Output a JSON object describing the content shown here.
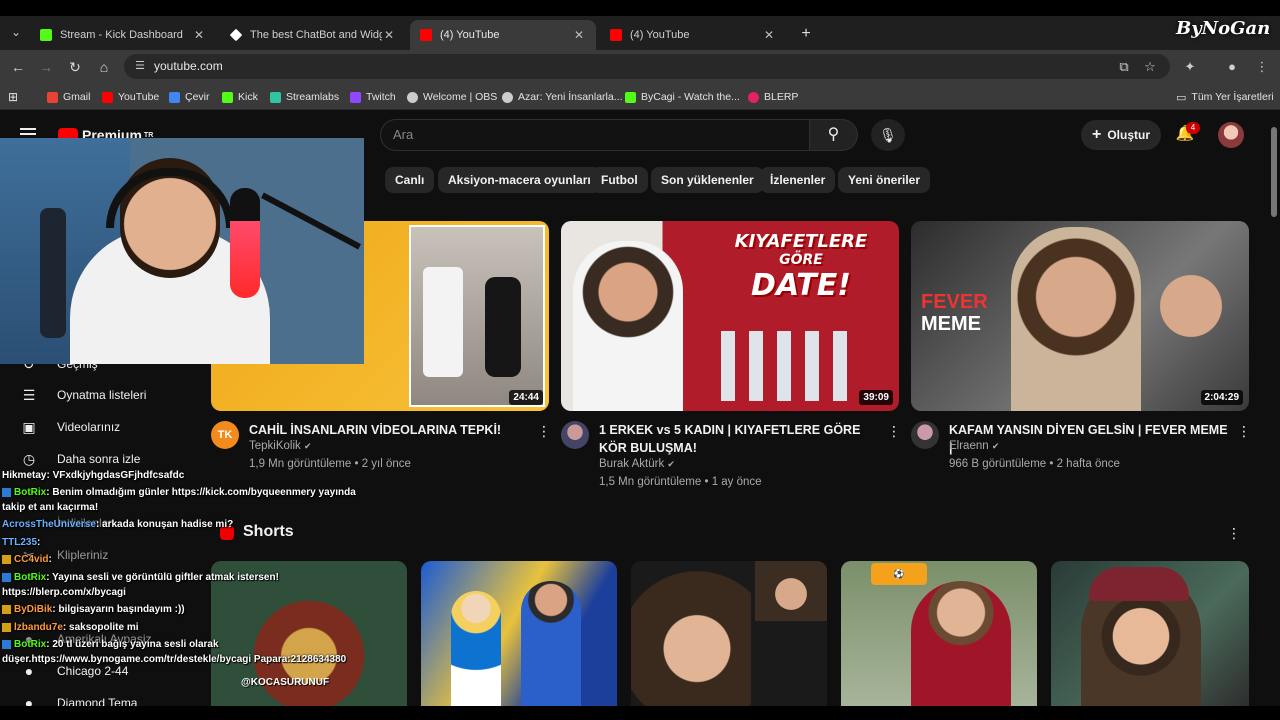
{
  "browser": {
    "tabs": [
      {
        "label": "Stream - Kick Dashboard",
        "favicon_color": "#53fc18"
      },
      {
        "label": "The best ChatBot and Widgets",
        "favicon_color": "#ffffff"
      },
      {
        "label": "(4) YouTube",
        "favicon_color": "#ff0000"
      },
      {
        "label": "(4) YouTube",
        "favicon_color": "#ff0000"
      }
    ],
    "url": "youtube.com",
    "bookmarks": [
      {
        "label": "Gmail",
        "color": "#ea4335"
      },
      {
        "label": "YouTube",
        "color": "#ff0000"
      },
      {
        "label": "Çevir",
        "color": "#4285f4"
      },
      {
        "label": "Kick",
        "color": "#53fc18"
      },
      {
        "label": "Streamlabs",
        "color": "#31c3a2"
      },
      {
        "label": "Twitch",
        "color": "#9146ff"
      },
      {
        "label": "Welcome | OBS",
        "color": "#cccccc"
      },
      {
        "label": "Azar: Yeni İnsanlarla...",
        "color": "#cccccc"
      },
      {
        "label": "ByCagi - Watch the...",
        "color": "#53fc18"
      },
      {
        "label": "BLERP",
        "color": "#e0245e"
      }
    ],
    "all_bookmarks_label": "Tüm Yer İşaretleri"
  },
  "overlay_logo": "ByNoGan",
  "youtube": {
    "logo_label": "Premium",
    "logo_sup": "TR",
    "search_placeholder": "Ara",
    "create_label": "Oluştur",
    "notification_count": "4",
    "chips": [
      "Canlı",
      "Aksiyon-macera oyunları",
      "Futbol",
      "Son yüklenenler",
      "İzlenenler",
      "Yeni öneriler"
    ],
    "sidebar": [
      {
        "label": "Geçmiş",
        "icon": "history-icon"
      },
      {
        "label": "Oynatma listeleri",
        "icon": "playlists-icon"
      },
      {
        "label": "Videolarınız",
        "icon": "your-videos-icon"
      },
      {
        "label": "Daha sonra izle",
        "icon": "watch-later-icon"
      },
      {
        "label": "İndirilenler",
        "icon": "downloads-icon"
      },
      {
        "label": "Klipleriniz",
        "icon": "clips-icon"
      },
      {
        "label": "Amerikalı Avpasiz",
        "icon": "channel-avatar"
      },
      {
        "label": "Chicago 2-44",
        "icon": "channel-avatar"
      },
      {
        "label": "Diamond Tema",
        "icon": "channel-avatar"
      }
    ],
    "videos": [
      {
        "title": "CAHİL İNSANLARIN VİDEOLARINA TEPKİ!",
        "channel": "TepkiKolik",
        "meta": "1,9 Mn görüntüleme • 2 yıl önce",
        "duration": "24:44",
        "avatar_text": "TK"
      },
      {
        "title": "1 ERKEK vs 5 KADIN | KIYAFETLERE GÖRE KÖR BULUŞMA!",
        "channel": "Burak Aktürk",
        "meta": "1,5 Mn görüntüleme • 1 ay önce",
        "duration": "39:09",
        "thumb_text_1": "KIYAFETLERE",
        "thumb_text_2": "GÖRE",
        "thumb_text_3": "DATE!"
      },
      {
        "title": "KAFAM YANSIN DİYEN GELSİN | FEVER MEME |",
        "channel": "Elraenn",
        "meta": "966 B görüntüleme • 2 hafta önce",
        "duration": "2:04:29",
        "thumb_text_1": "FEVER",
        "thumb_text_2": "MEME"
      }
    ],
    "shorts_title": "Shorts",
    "shorts_overlay_text": "@KOCASURUNUF"
  },
  "chat": [
    {
      "name": "Hikmetay",
      "msg": ": VFxdkjyhgdasGFjhdfcsafdc",
      "color": "#ffffff"
    },
    {
      "name": "BotRix",
      "msg": ": Benim olmadığım günler https://kick.com/byqueenmery yayında",
      "color": "#53fc18"
    },
    {
      "name": "",
      "msg": "takip et anı kaçırma!",
      "color": "#ffffff"
    },
    {
      "name": "AcrossTheUniverse",
      "msg": ": arkada konuşan hadise mi?",
      "color": "#6ab0ff"
    },
    {
      "name": "TTL235",
      "msg": ":",
      "color": "#6ab0ff"
    },
    {
      "name": "CC4vid",
      "msg": ":",
      "color": "#ff9a3c"
    },
    {
      "name": "BotRix",
      "msg": ": Yayına sesli ve görüntülü giftler atmak istersen!",
      "color": "#53fc18"
    },
    {
      "name": "",
      "msg": "https://blerp.com/x/bycagi",
      "color": "#ffffff"
    },
    {
      "name": "ByDiBik",
      "msg": ": bilgisayarın başındayım :))",
      "color": "#ff9a3c"
    },
    {
      "name": "lzbandu7e",
      "msg": ": saksopolite mi",
      "color": "#ff9a3c"
    },
    {
      "name": "BotRix",
      "msg": ": 20 tl üzeri bağış yayına sesli olarak",
      "color": "#53fc18"
    },
    {
      "name": "",
      "msg": "düşer.https://www.bynogame.com/tr/destekle/bycagi Papara:2128634380",
      "color": "#ffffff"
    }
  ]
}
